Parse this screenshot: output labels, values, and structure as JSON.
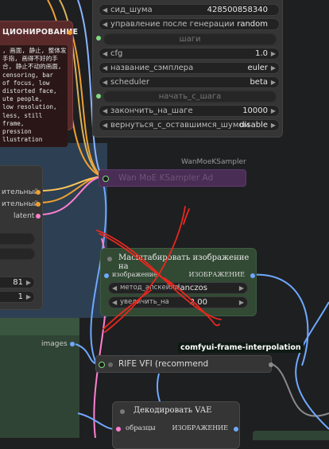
{
  "sampler_node": {
    "rows": [
      {
        "label": "сид_шума",
        "value": "428500858340"
      },
      {
        "label": "управление после генерации",
        "value": "random"
      },
      {
        "label": "шаги",
        "value": "",
        "dim": true
      },
      {
        "label": "cfg",
        "value": "1.0"
      },
      {
        "label": "название_сэмплера",
        "value": "euler"
      },
      {
        "label": "scheduler",
        "value": "beta"
      },
      {
        "label": "начать_с_шага",
        "value": "",
        "dim": true
      },
      {
        "label": "закончить_на_шаге",
        "value": "10000"
      },
      {
        "label": "вернуться_с_оставшимся_шумом",
        "value": "disable"
      }
    ]
  },
  "text_node": {
    "title": "ЦИОНИРОВАНИЕ",
    "lines": [
      ", 画面, 静止, 整体发",
      "手指, 画得不好的手",
      "合, 静止不动的画面,",
      "censoring, bar",
      "of focus, low",
      "distorted face,",
      "ute people,",
      "low resolution,",
      "less, still frame,",
      "pression",
      "llustration"
    ]
  },
  "wan_node": {
    "group_label": "WanMoeKSampler",
    "title": "Wan MoE KSampler Ad"
  },
  "left_node": {
    "outputs": [
      "ительный",
      "ительный",
      "latent"
    ],
    "values": [
      "81",
      "1"
    ]
  },
  "images_label": "images",
  "scale_node": {
    "title": "Масштабировать изображение на",
    "input_label": "изображение",
    "output_label": "ИЗОБРАЖЕНИЕ",
    "rows": [
      {
        "label": "метод_апскейла",
        "value": "lanczos"
      },
      {
        "label": "увеличить_на",
        "value": "2.00"
      }
    ]
  },
  "group_title": "comfyui-frame-interpolation",
  "rife_node": {
    "title": "RIFE VFI (recommend"
  },
  "vae_node": {
    "title": "Декодировать VAE",
    "input_label": "образцы",
    "output_label": "ИЗОБРАЖЕНИЕ"
  },
  "colors": {
    "canvas": "#1e1f21",
    "node_body": "#353535",
    "text_node": "#5a2a2a",
    "wan_node": "#4a2d55",
    "scale_node": "#324a34",
    "group_blue": "#2d3f52",
    "group_green": "#2f4434",
    "annotation": "#e8281e"
  }
}
